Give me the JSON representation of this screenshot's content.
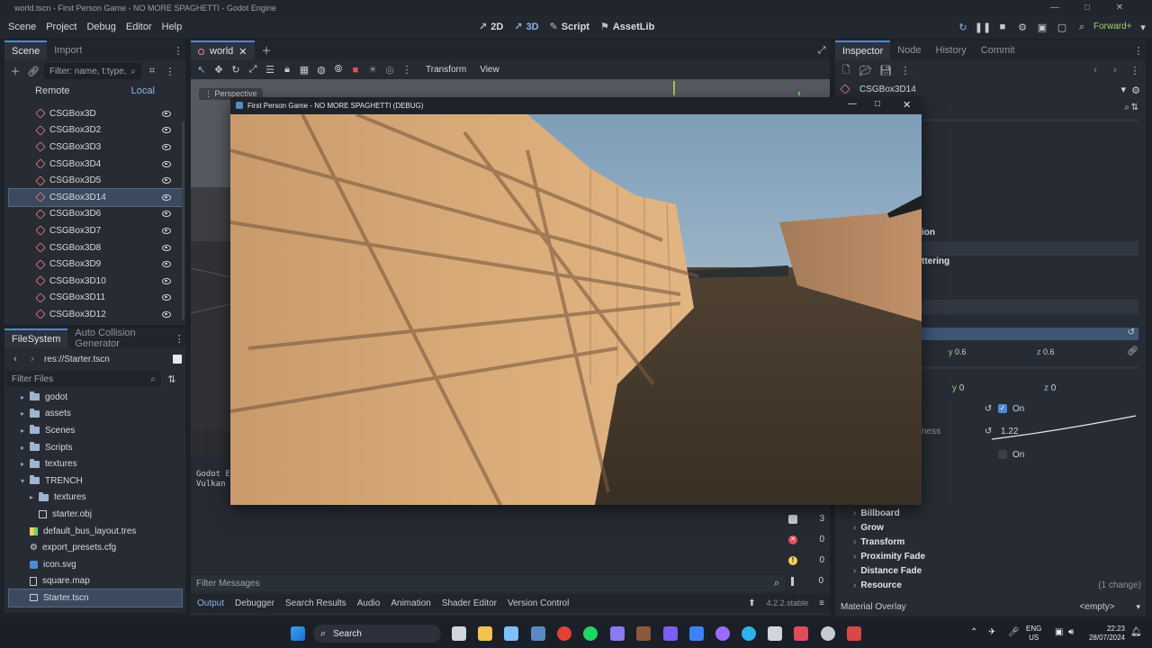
{
  "window": {
    "title": "world.tscn - First Person Game - NO MORE SPAGHETTI - Godot Engine"
  },
  "menu": {
    "items": [
      "Scene",
      "Project",
      "Debug",
      "Editor",
      "Help"
    ]
  },
  "modes": {
    "d2": "2D",
    "d3": "3D",
    "script": "Script",
    "assetlib": "AssetLib"
  },
  "renderer": "Forward+",
  "scene_dock": {
    "tabs": [
      "Scene",
      "Import"
    ],
    "filter_placeholder": "Filter: name, t:type, ",
    "remote": "Remote",
    "local": "Local",
    "nodes": [
      "CSGBox3D",
      "CSGBox3D2",
      "CSGBox3D3",
      "CSGBox3D4",
      "CSGBox3D5",
      "CSGBox3D14",
      "CSGBox3D6",
      "CSGBox3D7",
      "CSGBox3D8",
      "CSGBox3D9",
      "CSGBox3D10",
      "CSGBox3D11",
      "CSGBox3D12"
    ],
    "selected_index": 5
  },
  "filesystem": {
    "tabs": [
      "FileSystem",
      "Auto Collision Generator"
    ],
    "path": "res://Starter.tscn",
    "filter_placeholder": "Filter Files",
    "items": [
      {
        "name": "godot",
        "kind": "folder",
        "indent": 1
      },
      {
        "name": "assets",
        "kind": "folder",
        "indent": 1
      },
      {
        "name": "Scenes",
        "kind": "folder",
        "indent": 1
      },
      {
        "name": "Scripts",
        "kind": "folder",
        "indent": 1
      },
      {
        "name": "textures",
        "kind": "folder",
        "indent": 1
      },
      {
        "name": "TRENCH",
        "kind": "folder-open",
        "indent": 1
      },
      {
        "name": "textures",
        "kind": "folder",
        "indent": 2
      },
      {
        "name": "starter.obj",
        "kind": "mesh",
        "indent": 2
      },
      {
        "name": "default_bus_layout.tres",
        "kind": "bus",
        "indent": 1
      },
      {
        "name": "export_presets.cfg",
        "kind": "gear",
        "indent": 1
      },
      {
        "name": "icon.svg",
        "kind": "image",
        "indent": 1
      },
      {
        "name": "square.map",
        "kind": "file",
        "indent": 1
      },
      {
        "name": "Starter.tscn",
        "kind": "scene",
        "indent": 1,
        "selected": true
      }
    ]
  },
  "editor_tabs": {
    "current": "world"
  },
  "viewport_toolbar": {
    "transform": "Transform",
    "view": "View",
    "perspective": "Perspective"
  },
  "game_window": {
    "title": "First Person Game - NO MORE SPAGHETTI (DEBUG)"
  },
  "output": {
    "lines": [
      "Godot E",
      "Vulkan "
    ],
    "filter_placeholder": "Filter Messages",
    "counts": {
      "messages": "3",
      "errors": "0",
      "warnings": "0",
      "other": "0"
    },
    "bottom_tabs": [
      "Output",
      "Debugger",
      "Search Results",
      "Audio",
      "Animation",
      "Shader Editor",
      "Version Control"
    ],
    "version": "4.2.2.stable"
  },
  "inspector": {
    "tabs": [
      "Inspector",
      "Node",
      "History",
      "Commit"
    ],
    "node": "CSGBox3D14",
    "partial_labels": [
      "ion",
      "ttering",
      "ness"
    ],
    "y_label": "y",
    "z_label": "z",
    "vec1": {
      "y": "0.6",
      "z": "0.6"
    },
    "vec2": {
      "y": "0",
      "z": "0"
    },
    "on1": "On",
    "curve_value": "1.22",
    "on2": "On",
    "sections": [
      "Billboard",
      "Grow",
      "Transform",
      "Proximity Fade",
      "Distance Fade",
      "Resource"
    ],
    "change_note": "(1 change)",
    "material_overlay_label": "Material Overlay",
    "material_overlay_value": "<empty>"
  },
  "taskbar": {
    "search": "Search",
    "lang1": "ENG",
    "lang2": "US",
    "time": "22:23",
    "date": "28/07/2024"
  },
  "colors": {
    "accent": "#4b8ad6",
    "csg": "#fc7f7f",
    "error": "#e0525a",
    "warning": "#f5d05c"
  }
}
